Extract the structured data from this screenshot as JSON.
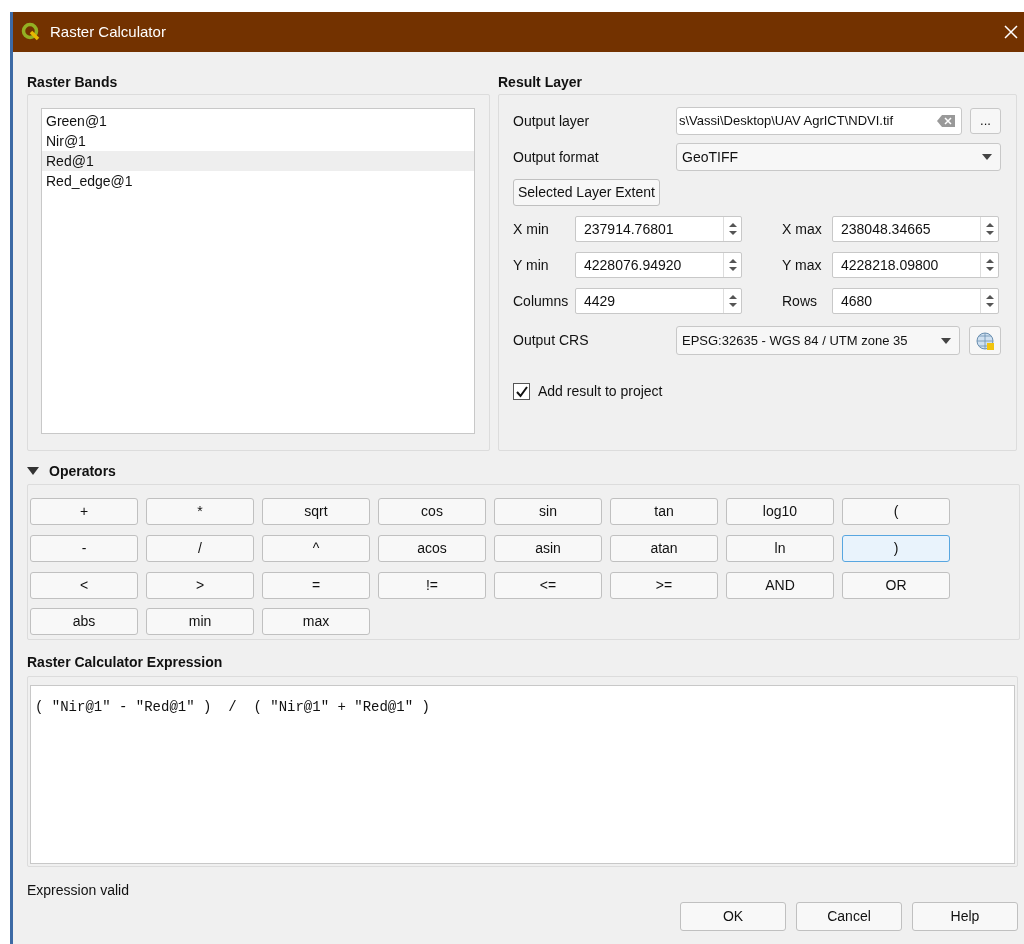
{
  "window": {
    "title": "Raster Calculator"
  },
  "raster_bands": {
    "heading": "Raster Bands",
    "items": [
      {
        "label": "Green@1",
        "selected": false
      },
      {
        "label": "Nir@1",
        "selected": false
      },
      {
        "label": "Red@1",
        "selected": true
      },
      {
        "label": "Red_edge@1",
        "selected": false
      }
    ]
  },
  "result_layer": {
    "heading": "Result Layer",
    "output_layer": {
      "label": "Output layer",
      "value": "s\\Vassi\\Desktop\\UAV AgrICT\\NDVI.tif",
      "browse": "..."
    },
    "output_format": {
      "label": "Output format",
      "value": "GeoTIFF"
    },
    "extent_button": "Selected Layer Extent",
    "spinners": [
      {
        "label": "X min",
        "value": "237914.76801"
      },
      {
        "label": "X max",
        "value": "238048.34665"
      },
      {
        "label": "Y min",
        "value": "4228076.94920"
      },
      {
        "label": "Y max",
        "value": "4228218.09800"
      },
      {
        "label": "Columns",
        "value": "4429"
      },
      {
        "label": "Rows",
        "value": "4680"
      }
    ],
    "output_crs": {
      "label": "Output CRS",
      "value": "EPSG:32635 - WGS 84 / UTM zone 35"
    },
    "add_to_project": {
      "label": "Add result to project",
      "checked": true
    }
  },
  "operators": {
    "heading": "Operators",
    "expanded": true,
    "buttons": [
      {
        "label": "+",
        "focused": false
      },
      {
        "label": "*",
        "focused": false
      },
      {
        "label": "sqrt",
        "focused": false
      },
      {
        "label": "cos",
        "focused": false
      },
      {
        "label": "sin",
        "focused": false
      },
      {
        "label": "tan",
        "focused": false
      },
      {
        "label": "log10",
        "focused": false
      },
      {
        "label": "(",
        "focused": false
      },
      {
        "label": "-",
        "focused": false
      },
      {
        "label": "/",
        "focused": false
      },
      {
        "label": "^",
        "focused": false
      },
      {
        "label": "acos",
        "focused": false
      },
      {
        "label": "asin",
        "focused": false
      },
      {
        "label": "atan",
        "focused": false
      },
      {
        "label": "ln",
        "focused": false
      },
      {
        "label": ")",
        "focused": true
      },
      {
        "label": "<",
        "focused": false
      },
      {
        "label": ">",
        "focused": false
      },
      {
        "label": "=",
        "focused": false
      },
      {
        "label": "!=",
        "focused": false
      },
      {
        "label": "<=",
        "focused": false
      },
      {
        "label": ">=",
        "focused": false
      },
      {
        "label": "AND",
        "focused": false
      },
      {
        "label": "OR",
        "focused": false
      },
      {
        "label": "abs",
        "focused": false
      },
      {
        "label": "min",
        "focused": false
      },
      {
        "label": "max",
        "focused": false
      }
    ]
  },
  "expression": {
    "heading": "Raster Calculator Expression",
    "value": "( \"Nir@1\" - \"Red@1\" )  /  ( \"Nir@1\" + \"Red@1\" )",
    "status": "Expression valid"
  },
  "buttons": [
    "OK",
    "Cancel",
    "Help"
  ]
}
